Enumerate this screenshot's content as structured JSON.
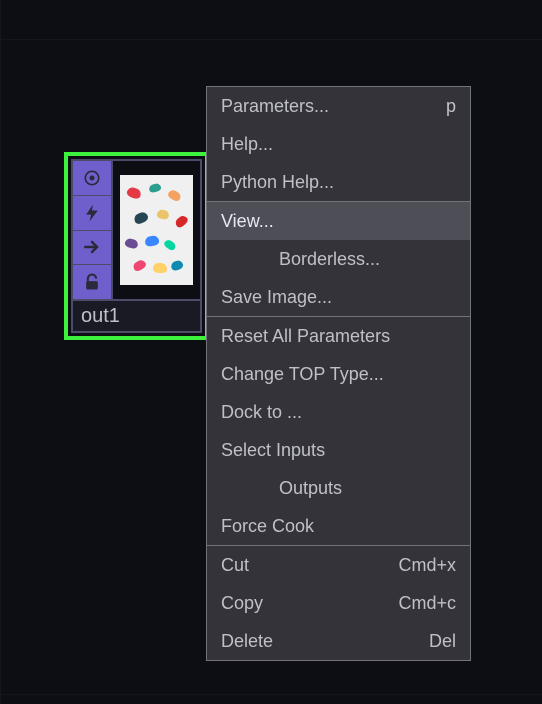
{
  "node": {
    "name": "out1",
    "flags": {
      "viewer": "viewer-flag",
      "bypass": "bypass-flag",
      "clone": "clone-immune-flag",
      "lock": "lock-flag"
    }
  },
  "menu": {
    "parameters": {
      "label": "Parameters...",
      "shortcut": "p"
    },
    "help": {
      "label": "Help..."
    },
    "python_help": {
      "label": "Python Help..."
    },
    "view": {
      "label": "View..."
    },
    "borderless": {
      "label": "Borderless..."
    },
    "save_image": {
      "label": "Save Image..."
    },
    "reset_all": {
      "label": "Reset All Parameters"
    },
    "change_type": {
      "label": "Change TOP Type..."
    },
    "dock_to": {
      "label": "Dock to ..."
    },
    "select_inputs": {
      "label": "Select Inputs"
    },
    "outputs": {
      "label": "Outputs"
    },
    "force_cook": {
      "label": "Force Cook"
    },
    "cut": {
      "label": "Cut",
      "shortcut": "Cmd+x"
    },
    "copy": {
      "label": "Copy",
      "shortcut": "Cmd+c"
    },
    "delete": {
      "label": "Delete",
      "shortcut": "Del"
    }
  }
}
